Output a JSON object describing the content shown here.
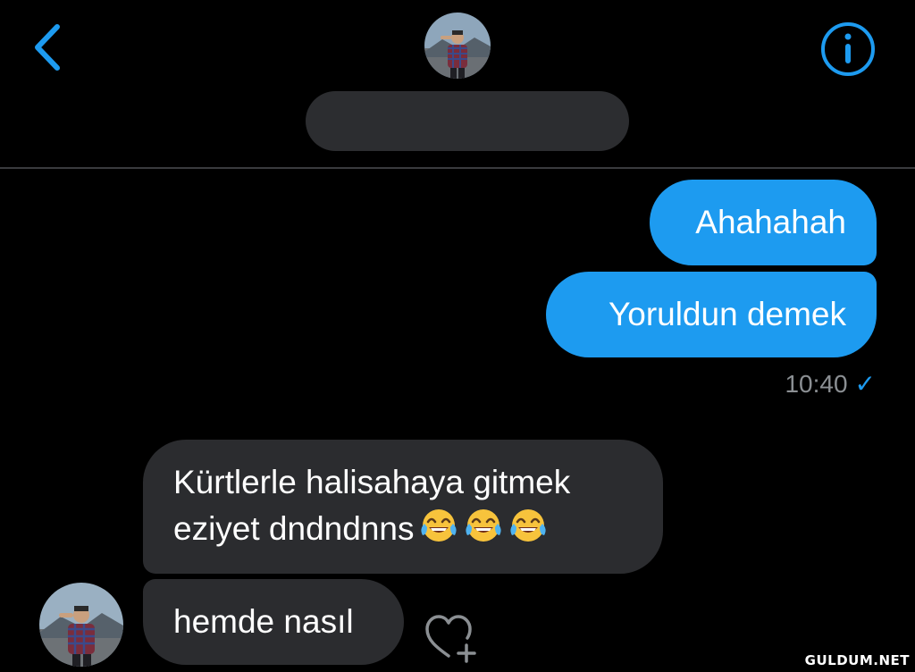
{
  "header": {
    "back_icon": "chevron-left-icon",
    "info_icon": "info-circle-icon",
    "contact_name": ""
  },
  "messages": [
    {
      "direction": "outgoing",
      "text": "Ahahahah"
    },
    {
      "direction": "outgoing",
      "text": "Yoruldun demek"
    },
    {
      "direction": "incoming",
      "lines": [
        "Kürtlerle halisahaya gitmek",
        "eziyet dndndnns"
      ],
      "emoji": [
        "face-with-tears-of-joy",
        "face-with-tears-of-joy",
        "face-with-tears-of-joy"
      ]
    },
    {
      "direction": "incoming",
      "text": "hemde nasıl"
    }
  ],
  "status": {
    "time": "10:40",
    "check": "✓"
  },
  "react_icon": "heart-plus-icon",
  "watermark": "GULDUM.NET",
  "colors": {
    "accent": "#1d9bf0",
    "outgoing_bubble": "#1d9bf0",
    "incoming_bubble": "#2b2c2f",
    "background": "#000000",
    "timestamp": "#8b8f93"
  }
}
